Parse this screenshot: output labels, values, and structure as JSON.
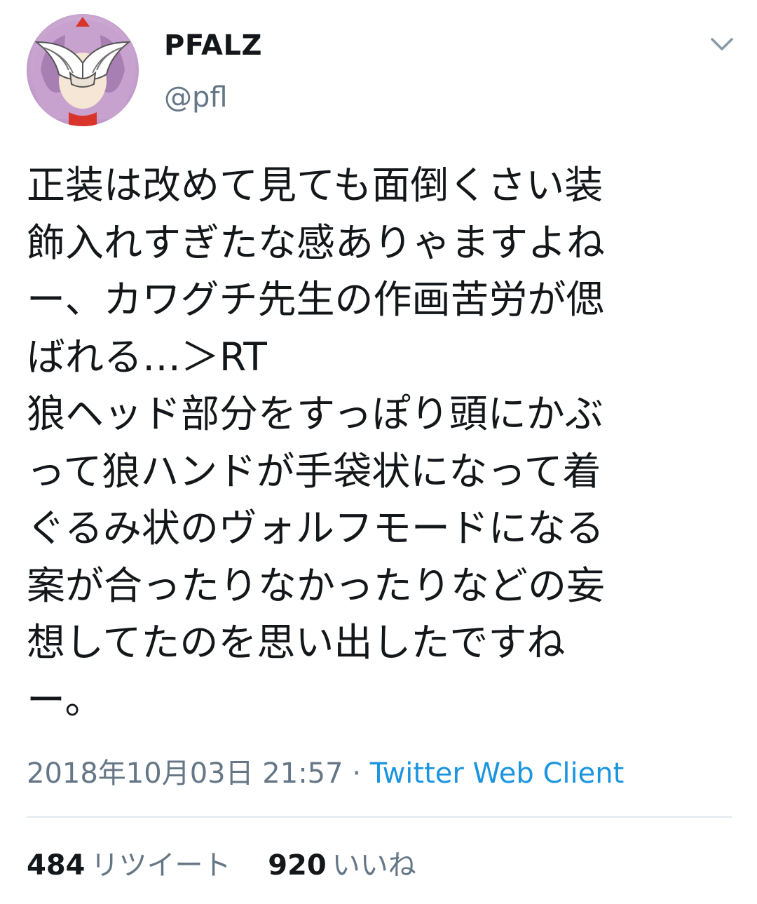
{
  "author": {
    "display_name": "PFALZ",
    "handle": "@pfl"
  },
  "menu_icon": "chevron-down-icon",
  "tweet": {
    "text": "正装は改めて見ても面倒くさい装\n飾入れすぎたな感ありゃますよね\nー、カワグチ先生の作画苦労が偲\nばれる…＞RT\n狼ヘッド部分をすっぽり頭にかぶ\nって狼ハンドが手袋状になって着\nぐるみ状のヴォルフモードになる\n案が合ったりなかったりなどの妄\n想してたのを思い出したですね\nー。",
    "datetime": "2018年10月03日 21:57",
    "separator": "·",
    "source": "Twitter Web Client"
  },
  "stats": {
    "retweets_count": "484",
    "retweets_label": "リツイート",
    "likes_count": "920",
    "likes_label": "いいね"
  },
  "colors": {
    "text": "#14171a",
    "secondary": "#657786",
    "link": "#1b95e0",
    "divider": "#e1e8ed"
  }
}
